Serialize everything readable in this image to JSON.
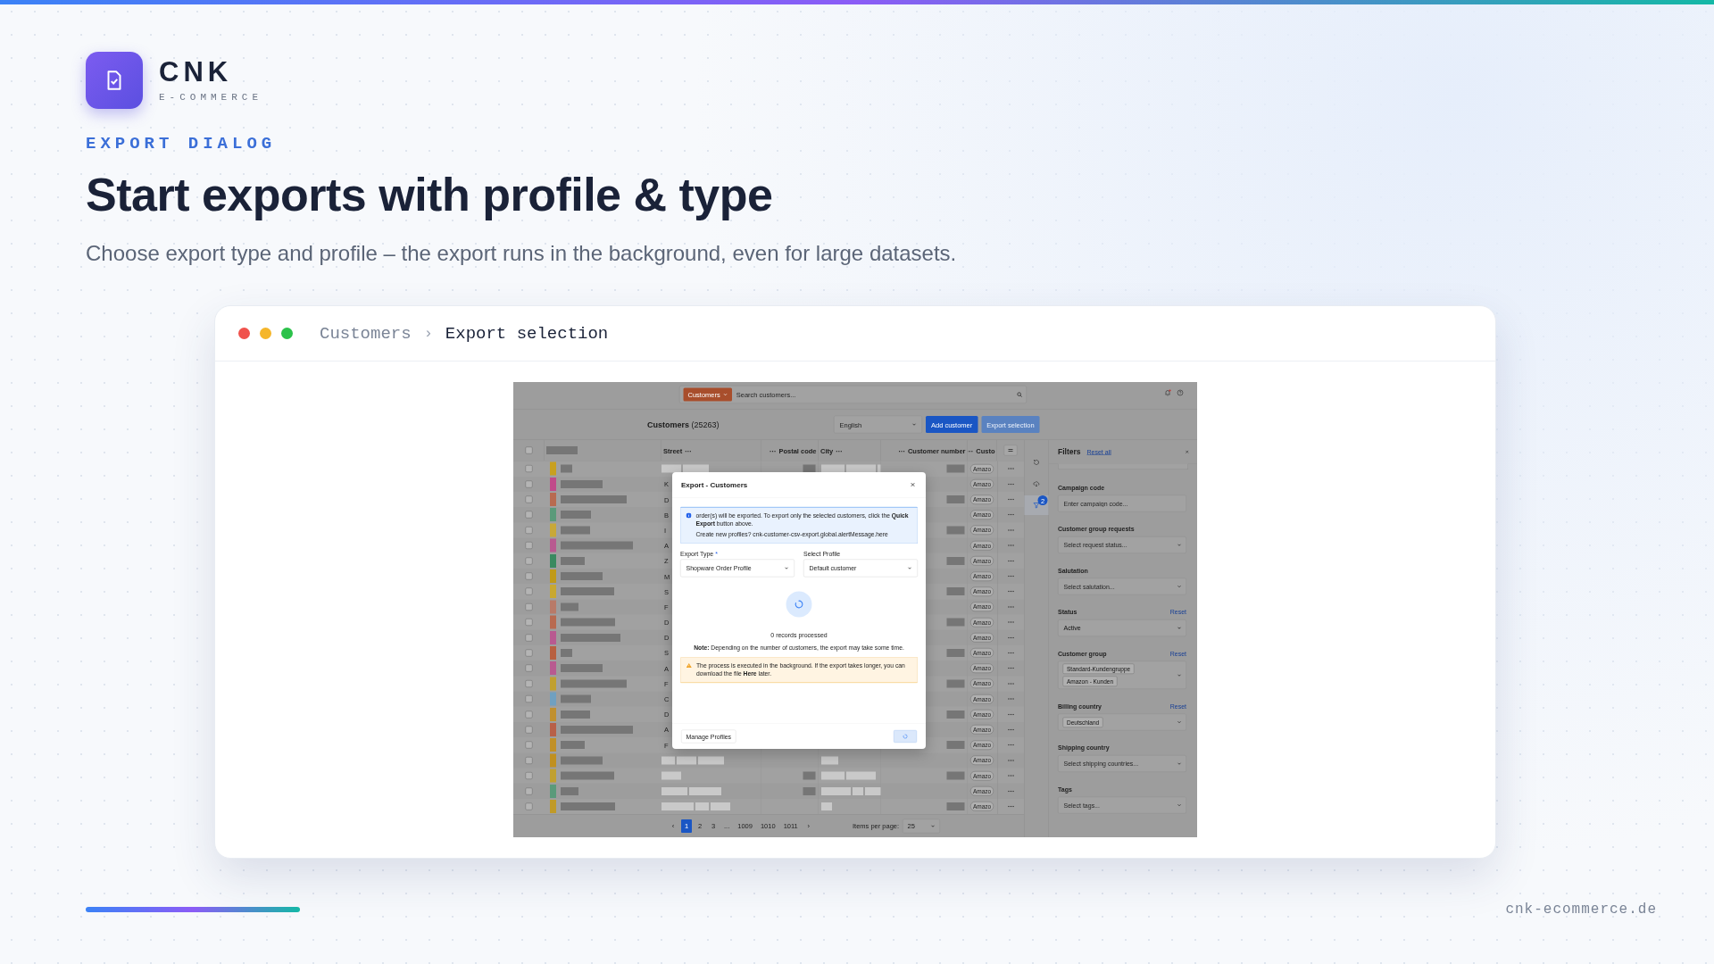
{
  "brand": {
    "name": "CNK",
    "tagline": "E-COMMERCE"
  },
  "eyebrow": "EXPORT DIALOG",
  "headline": "Start exports with profile & type",
  "subheadline": "Choose export type and profile – the export runs in the background, even for large datasets.",
  "window": {
    "separator": "›",
    "breadcrumb": [
      {
        "label": "Customers",
        "current": false
      },
      {
        "label": "Export selection",
        "current": true
      }
    ]
  },
  "app": {
    "topbar": {
      "scope_button": "Customers",
      "search_placeholder": "Search customers...",
      "notification_dot": true
    },
    "title": "Customers",
    "count": "(25263)",
    "language_select": "English",
    "add_button": "Add customer",
    "export_button": {
      "label": "Export selection",
      "disabled": true
    },
    "select_all_checked": false,
    "columns": [
      {
        "label": "Street",
        "menu_after": "···"
      },
      {
        "label": "Postal code",
        "menu_before": "···"
      },
      {
        "label": "City",
        "menu_after": "···"
      },
      {
        "label": "Customer number",
        "menu_before": "···"
      },
      {
        "label": "Custo",
        "menu_before": "···"
      }
    ],
    "rows": [
      {
        "checked": false,
        "color": "#c8a020",
        "badge": "Amazo"
      },
      {
        "checked": false,
        "color": "#c04a8a",
        "street": "K",
        "badge": "Amazo"
      },
      {
        "checked": false,
        "color": "#b86a50",
        "street": "D",
        "badge": "Amazo"
      },
      {
        "checked": false,
        "color": "#5a9a7a",
        "street": "B",
        "badge": "Amazo"
      },
      {
        "checked": false,
        "color": "#c8a838",
        "street": "I",
        "badge": "Amazo"
      },
      {
        "checked": false,
        "color": "#b85a90",
        "street": "A",
        "badge": "Amazo"
      },
      {
        "checked": false,
        "color": "#3a8a60",
        "street": "Z",
        "badge": "Amazo"
      },
      {
        "checked": false,
        "color": "#c09a18",
        "street": "M",
        "badge": "Amazo"
      },
      {
        "checked": false,
        "color": "#c8a830",
        "street": "S",
        "badge": "Amazo"
      },
      {
        "checked": false,
        "color": "#b87a68",
        "street": "F",
        "badge": "Amazo"
      },
      {
        "checked": false,
        "color": "#b86a50",
        "street": "D",
        "badge": "Amazo"
      },
      {
        "checked": false,
        "color": "#b85a90",
        "street": "D",
        "badge": "Amazo"
      },
      {
        "checked": false,
        "color": "#b86040",
        "street": "S",
        "badge": "Amazo"
      },
      {
        "checked": false,
        "color": "#b85a90",
        "street": "A",
        "badge": "Amazo"
      },
      {
        "checked": false,
        "color": "#c0a030",
        "street": "F",
        "badge": "Amazo"
      },
      {
        "checked": false,
        "color": "#70a0c0",
        "street": "C",
        "badge": "Amazo"
      },
      {
        "checked": false,
        "color": "#c09030",
        "street": "D",
        "badge": "Amazo"
      },
      {
        "checked": false,
        "color": "#b86048",
        "street": "A",
        "badge": "Amazo"
      },
      {
        "checked": false,
        "color": "#c09028",
        "street": "F",
        "badge": "Amazo"
      },
      {
        "checked": false,
        "color": "#c09020",
        "badge": "Amazo"
      },
      {
        "checked": false,
        "color": "#c0a030",
        "badge": "Amazo"
      },
      {
        "checked": false,
        "color": "#5a9a7a",
        "badge": "Amazo"
      },
      {
        "checked": false,
        "color": "#c09a28",
        "badge": "Amazo"
      }
    ],
    "pagination": {
      "prev": "‹",
      "next": "›",
      "pages": [
        {
          "label": "1",
          "selected": true
        },
        {
          "label": "2",
          "selected": false
        },
        {
          "label": "3",
          "selected": false
        },
        {
          "label": "...",
          "selected": false
        },
        {
          "label": "1009",
          "selected": false
        },
        {
          "label": "1010",
          "selected": false
        },
        {
          "label": "1011",
          "selected": false
        }
      ],
      "items_label": "Items per page:",
      "items_value": "25"
    },
    "side_tools": [
      {
        "kind": "refresh",
        "selected": false
      },
      {
        "kind": "cloud",
        "selected": false
      },
      {
        "kind": "filter",
        "selected": true,
        "badge": "2"
      }
    ],
    "filters": {
      "title": "Filters",
      "reset_all": "Reset all",
      "fields": [
        {
          "kind": "input",
          "label": "Campaign code",
          "placeholder": "Enter campaign code..."
        },
        {
          "kind": "select",
          "label": "Customer group requests",
          "placeholder": "Select request status..."
        },
        {
          "kind": "select",
          "label": "Salutation",
          "placeholder": "Select salutation..."
        },
        {
          "kind": "select",
          "label": "Status",
          "reset": "Reset",
          "value": "Active"
        },
        {
          "kind": "chips",
          "label": "Customer group",
          "reset": "Reset",
          "chips": [
            "Standard-Kundengruppe",
            "Amazon - Kunden"
          ]
        },
        {
          "kind": "chips",
          "label": "Billing country",
          "reset": "Reset",
          "chips": [
            "Deutschland"
          ]
        },
        {
          "kind": "select",
          "label": "Shipping country",
          "placeholder": "Select shipping countries..."
        },
        {
          "kind": "select",
          "label": "Tags",
          "placeholder": "Select tags..."
        }
      ]
    }
  },
  "dialog": {
    "title": "Export - Customers",
    "info": [
      "order(s) will be exported. To export only the selected customers, click the **Quick Export** button above.",
      "Create new profiles? cnk-customer-csv-export.global.alertMessage.here"
    ],
    "fields": [
      {
        "label": "Export Type",
        "required_mark": "*",
        "value": "Shopware Order Profile"
      },
      {
        "label": "Select Profile",
        "value": "Default customer"
      }
    ],
    "progress": "0 records processed",
    "note": "**Note:** Depending on the number of customers, the export may take some time.",
    "warning": "The process is executed in the background. If the export takes longer, you can download the file **Here** later.",
    "manage_button": "Manage Profiles",
    "submit_loading": true
  },
  "footer": {
    "domain": "cnk-ecommerce.de"
  }
}
